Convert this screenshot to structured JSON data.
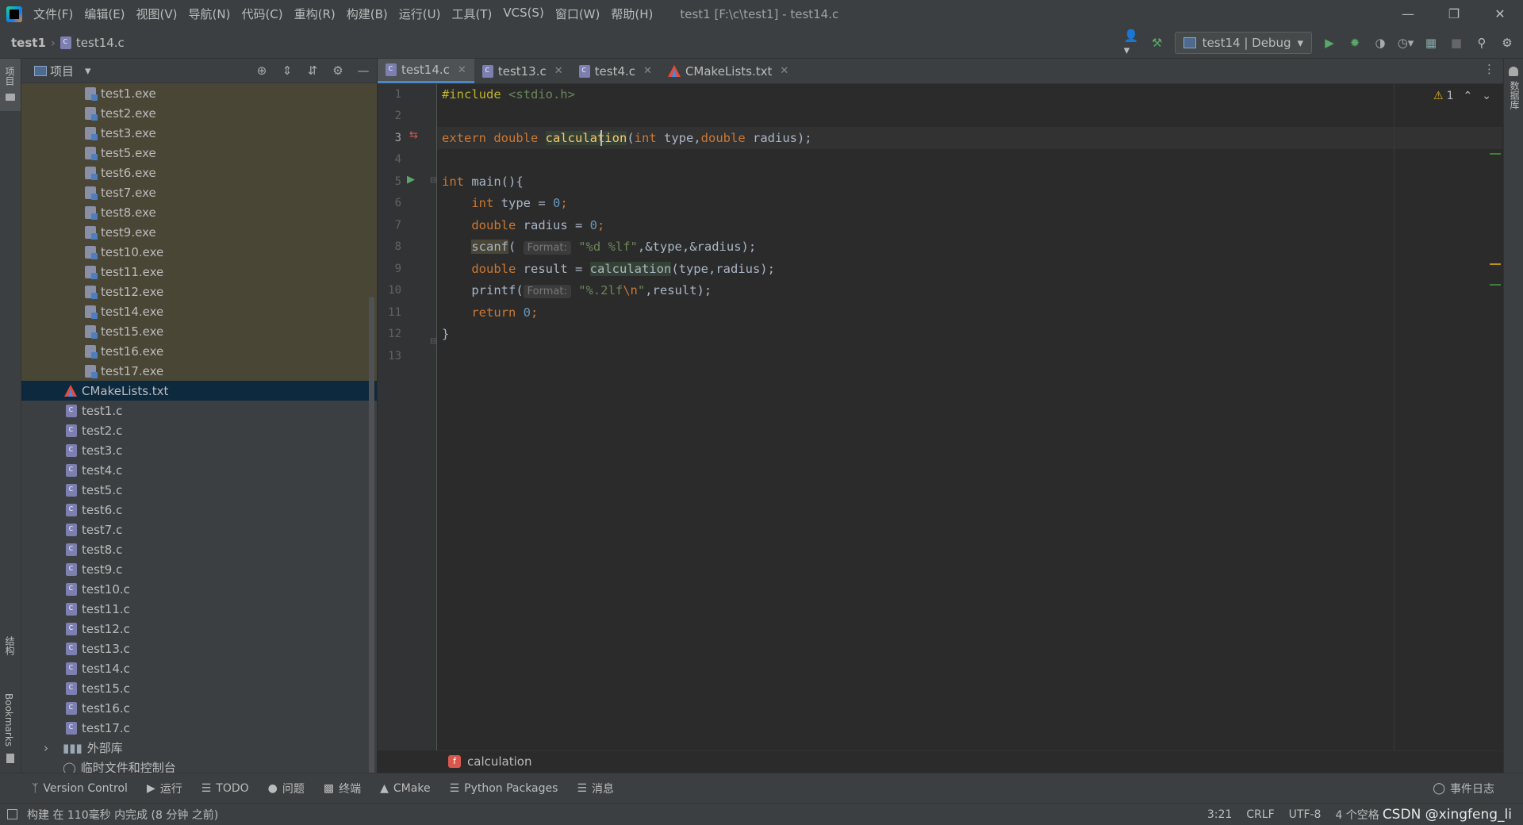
{
  "window": {
    "menu": [
      "文件(F)",
      "编辑(E)",
      "视图(V)",
      "导航(N)",
      "代码(C)",
      "重构(R)",
      "构建(B)",
      "运行(U)",
      "工具(T)",
      "VCS(S)",
      "窗口(W)",
      "帮助(H)"
    ],
    "title": "test1 [F:\\c\\test1] - test14.c"
  },
  "navbar": {
    "project": "test1",
    "file": "test14.c",
    "run_config": "test14 | Debug"
  },
  "left_stripe": {
    "project": "项目",
    "structure": "结构",
    "bookmarks": "Bookmarks"
  },
  "right_stripe": {
    "database": "数据库"
  },
  "project_panel": {
    "title": "项目",
    "exe_files": [
      "test1.exe",
      "test2.exe",
      "test3.exe",
      "test5.exe",
      "test6.exe",
      "test7.exe",
      "test8.exe",
      "test9.exe",
      "test10.exe",
      "test11.exe",
      "test12.exe",
      "test14.exe",
      "test15.exe",
      "test16.exe",
      "test17.exe"
    ],
    "cmake_file": "CMakeLists.txt",
    "source_files": [
      "test1.c",
      "test2.c",
      "test3.c",
      "test4.c",
      "test5.c",
      "test6.c",
      "test7.c",
      "test8.c",
      "test9.c",
      "test10.c",
      "test11.c",
      "test12.c",
      "test13.c",
      "test14.c",
      "test15.c",
      "test16.c",
      "test17.c"
    ],
    "external_libs": "外部库",
    "scratches": "临时文件和控制台"
  },
  "tabs": [
    {
      "label": "test14.c",
      "active": true
    },
    {
      "label": "test13.c",
      "active": false
    },
    {
      "label": "test4.c",
      "active": false
    },
    {
      "label": "CMakeLists.txt",
      "active": false
    }
  ],
  "editor": {
    "line_numbers": [
      "1",
      "2",
      "3",
      "4",
      "5",
      "6",
      "7",
      "8",
      "9",
      "10",
      "11",
      "12",
      "13"
    ],
    "current_line": 3,
    "warnings": "1",
    "code": {
      "l1_include": "#include",
      "l1_header": " <stdio.h>",
      "l3_extern": "extern",
      "l3_double": " double ",
      "l3_fn": "calculation",
      "l3_paren": "(",
      "l3_int": "int",
      "l3_type": " type,",
      "l3_double2": "double",
      "l3_rest": " radius);",
      "l5_int": "int",
      "l5_rest": " main(){",
      "l6_int": "    int",
      "l6_mid": " type = ",
      "l6_num": "0",
      "l6_end": ";",
      "l7_double": "    double",
      "l7_mid": " radius = ",
      "l7_num": "0",
      "l7_end": ";",
      "l8_indent": "    ",
      "l8_fn": "scanf",
      "l8_paren": "( ",
      "l8_hint": "Format:",
      "l8_str": " \"%d %lf\"",
      "l8_rest": ",&type,&radius);",
      "l9_double": "    double",
      "l9_mid": " result = ",
      "l9_fn": "calculation",
      "l9_rest": "(type,radius);",
      "l10_fn": "    printf(",
      "l10_hint": "Format:",
      "l10_str": " \"%.2lf",
      "l10_esc": "\\n",
      "l10_str2": "\"",
      "l10_rest": ",result);",
      "l11_return": "    return",
      "l11_sp": " ",
      "l11_num": "0",
      "l11_end": ";",
      "l12_close": "}"
    },
    "breadcrumb_function": "calculation"
  },
  "tool_tabs": [
    "Version Control",
    "运行",
    "TODO",
    "问题",
    "终端",
    "CMake",
    "Python Packages",
    "消息"
  ],
  "event_log": "事件日志",
  "status": {
    "message": "构建 在 110毫秒 内完成 (8 分钟 之前)",
    "position": "3:21",
    "line_sep": "CRLF",
    "encoding": "UTF-8",
    "indent": "4 个空格",
    "watermark": "CSDN @xingfeng_li"
  },
  "colors": {
    "background": "#2b2b2b",
    "panel": "#3c3f41",
    "keyword": "#cc7832",
    "string": "#6a8759",
    "number": "#6897bb",
    "function": "#ffc66d",
    "selection": "#0d293e"
  }
}
